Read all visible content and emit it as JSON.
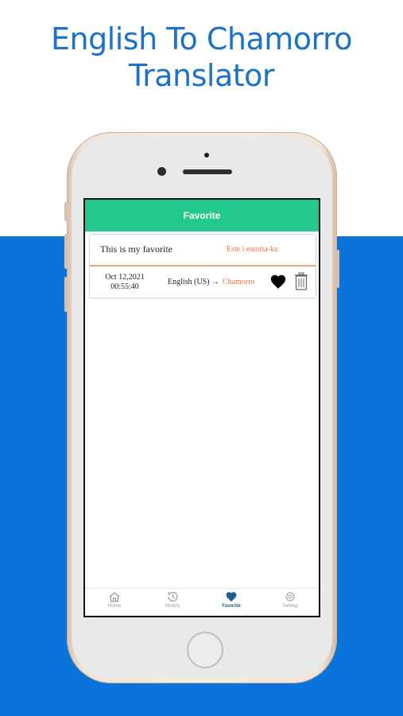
{
  "promo": {
    "line1": "English To Chamorro",
    "line2": "Translator"
  },
  "colors": {
    "headline": "#1b72c6",
    "band": "#0a74db",
    "appbar": "#22c98b",
    "accent_orange": "#e8733f",
    "tab_active": "#1f5c8e"
  },
  "app": {
    "title": "Favorite",
    "favorites": [
      {
        "source_text": "This is my favorite",
        "translated_text": "Este i estoria-ku",
        "date": "Oct 12,2021",
        "time": "00:55:40",
        "from_lang": "English (US) →",
        "to_lang": "Chamorro",
        "favorite_icon": "heart-filled",
        "delete_icon": "trash"
      }
    ],
    "tabs": [
      {
        "label": "Home",
        "icon": "home-icon",
        "active": false
      },
      {
        "label": "History",
        "icon": "history-icon",
        "active": false
      },
      {
        "label": "Favorite",
        "icon": "heart-icon",
        "active": true
      },
      {
        "label": "Setting",
        "icon": "gear-icon",
        "active": false
      }
    ]
  }
}
